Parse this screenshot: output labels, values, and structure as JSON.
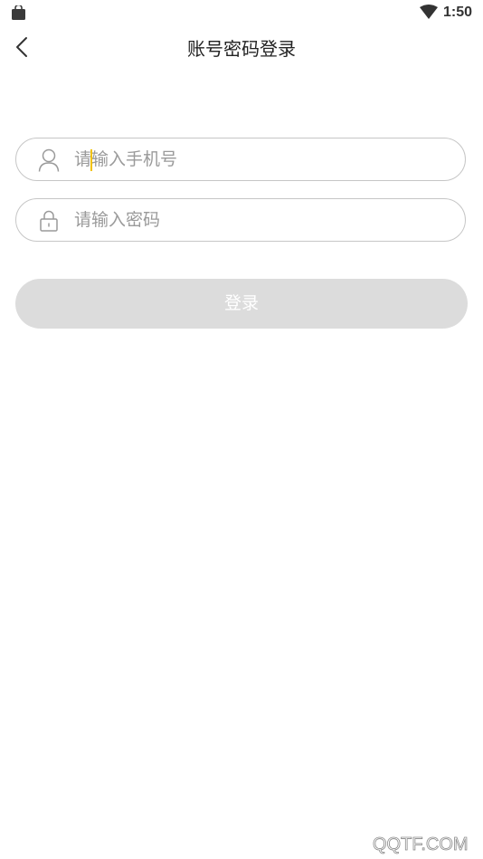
{
  "status_bar": {
    "time": "1:50",
    "icons": [
      "shopping-bag-icon",
      "wifi-icon"
    ]
  },
  "nav": {
    "back_icon": "chevron-left-icon",
    "title": "账号密码登录"
  },
  "form": {
    "phone": {
      "icon": "user-icon",
      "placeholder": "请输入手机号",
      "value": ""
    },
    "password": {
      "icon": "lock-icon",
      "placeholder": "请输入密码",
      "value": ""
    },
    "submit_label": "登录"
  },
  "colors": {
    "caret": "#f2c200",
    "button_disabled": "#dcdcdc",
    "border": "#c6c6c6"
  },
  "watermark": "QQTF.COM"
}
